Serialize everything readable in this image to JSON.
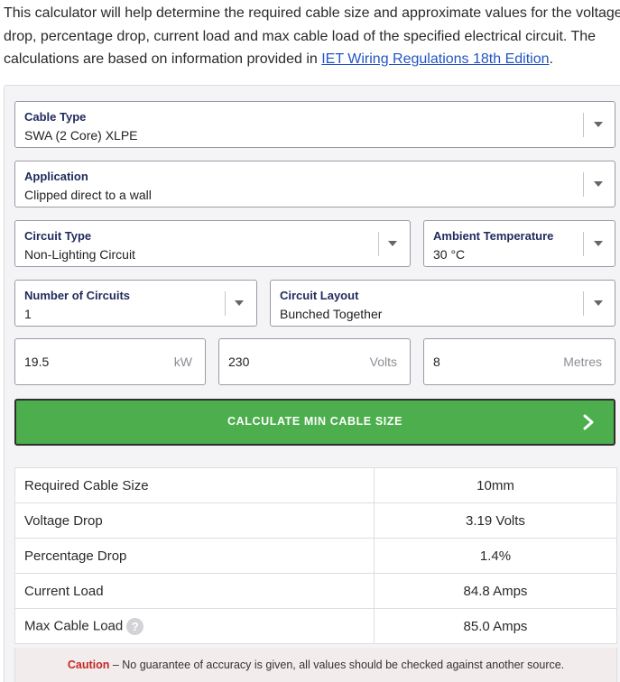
{
  "intro": {
    "line1": "This calculator will help determine the required cable size and approximate values for the voltage",
    "line2": "drop, percentage drop, current load and max cable load of the specified electrical circuit. The",
    "line3_prefix": "calculations are based on information provided in ",
    "link_text": "IET Wiring Regulations 18th Edition",
    "line3_suffix": "."
  },
  "form": {
    "cable_type": {
      "label": "Cable Type",
      "value": "SWA (2 Core) XLPE"
    },
    "application": {
      "label": "Application",
      "value": "Clipped direct to a wall"
    },
    "circuit_type": {
      "label": "Circuit Type",
      "value": "Non-Lighting Circuit"
    },
    "ambient_temperature": {
      "label": "Ambient Temperature",
      "value": "30 °C"
    },
    "number_of_circuits": {
      "label": "Number of Circuits",
      "value": "1"
    },
    "circuit_layout": {
      "label": "Circuit Layout",
      "value": "Bunched Together"
    },
    "power": {
      "value": "19.5",
      "unit": "kW"
    },
    "voltage": {
      "value": "230",
      "unit": "Volts"
    },
    "length": {
      "value": "8",
      "unit": "Metres"
    }
  },
  "calculate_button": {
    "label": "CALCULATE MIN CABLE SIZE"
  },
  "results": [
    {
      "label": "Required Cable Size",
      "value": "10mm"
    },
    {
      "label": "Voltage Drop",
      "value": "3.19 Volts"
    },
    {
      "label": "Percentage Drop",
      "value": "1.4%"
    },
    {
      "label": "Current Load",
      "value": "84.8 Amps"
    },
    {
      "label": "Max Cable Load",
      "value": "85.0 Amps"
    }
  ],
  "help_icon_glyph": "?",
  "caution": {
    "label": "Caution",
    "text": " – No guarantee of accuracy is given, all values should be checked against another source."
  }
}
